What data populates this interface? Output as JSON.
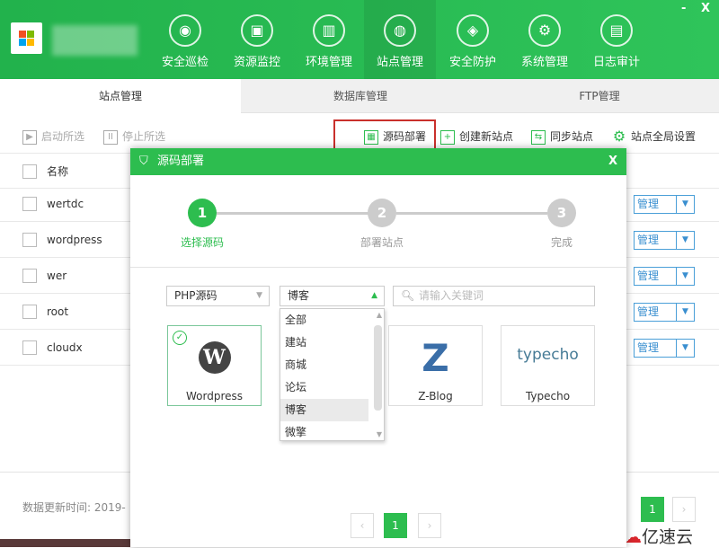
{
  "header": {
    "nav": [
      {
        "label": "安全巡检",
        "icon": "scan-icon"
      },
      {
        "label": "资源监控",
        "icon": "monitor-icon"
      },
      {
        "label": "环境管理",
        "icon": "building-icon"
      },
      {
        "label": "站点管理",
        "icon": "globe-icon",
        "active": true
      },
      {
        "label": "安全防护",
        "icon": "shield-icon"
      },
      {
        "label": "系统管理",
        "icon": "settings-monitor-icon"
      },
      {
        "label": "日志审计",
        "icon": "document-icon"
      }
    ],
    "minimize": "-",
    "close": "X"
  },
  "tabs": [
    "站点管理",
    "数据库管理",
    "FTP管理"
  ],
  "toolbar": {
    "start": "启动所选",
    "stop": "停止所选",
    "deploy": "源码部署",
    "create": "创建新站点",
    "sync": "同步站点",
    "settings": "站点全局设置"
  },
  "table": {
    "header": "名称",
    "rows": [
      "wertdc",
      "wordpress",
      "wer",
      "root",
      "cloudx"
    ],
    "manage": "管理"
  },
  "footer": {
    "update_time": "数据更新时间: 2019-",
    "page": "1"
  },
  "dialog": {
    "title": "源码部署",
    "close": "X",
    "steps": [
      {
        "num": "1",
        "label": "选择源码",
        "active": true
      },
      {
        "num": "2",
        "label": "部署站点"
      },
      {
        "num": "3",
        "label": "完成"
      }
    ],
    "type_select": "PHP源码",
    "category_select": "博客",
    "search_placeholder": "请输入关键词",
    "category_options": [
      "全部",
      "建站",
      "商城",
      "论坛",
      "博客",
      "微擎"
    ],
    "apps": [
      {
        "name": "Wordpress",
        "selected": true
      },
      {
        "name": "Z-Blog"
      },
      {
        "name": "Typecho",
        "logo": "typecho"
      }
    ],
    "page": "1"
  },
  "watermark": "亿速云",
  "colors": {
    "brand": "#2dbd4f",
    "highlight": "#c9302c"
  }
}
